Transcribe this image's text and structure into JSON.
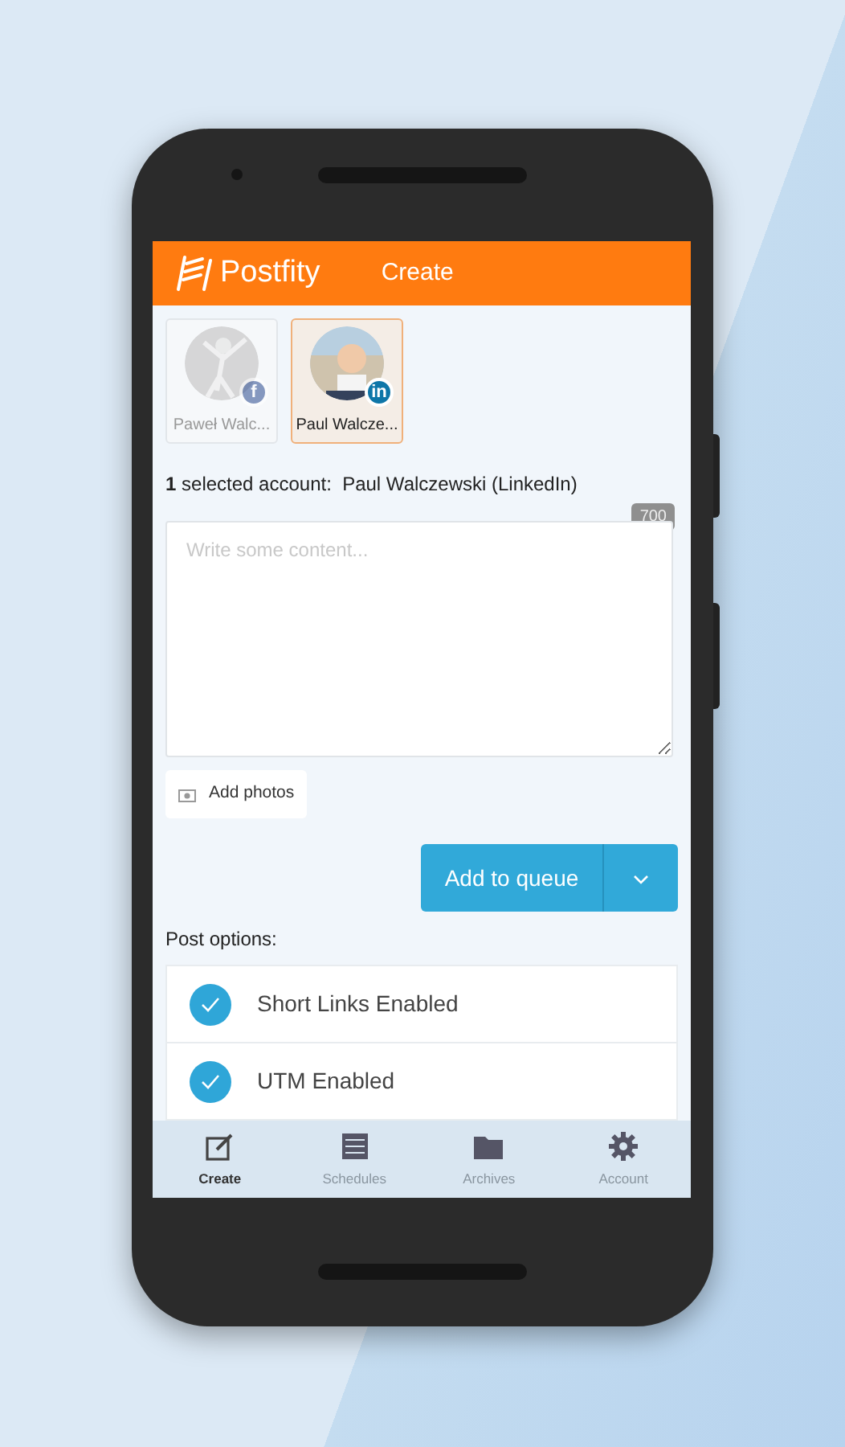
{
  "app_bar": {
    "logo": "Postfity",
    "title": "Create"
  },
  "accounts": [
    {
      "name": "Paweł Walc...",
      "kind": "facebook",
      "badge": "f",
      "selected": false
    },
    {
      "name": "Paul Walcze...",
      "kind": "linkedin",
      "badge": "in",
      "selected": true
    }
  ],
  "selection_summary": {
    "count": "1",
    "label": "selected account:",
    "accounts": "Paul Walczewski (LinkedIn)"
  },
  "composer": {
    "char_counter": "700",
    "placeholder": "Write some content..."
  },
  "add_photos": "Add photos",
  "add_to_queue": "Add to queue",
  "post_options": {
    "heading": "Post options:",
    "items": [
      {
        "label": "Short Links Enabled",
        "checked": true
      },
      {
        "label": "UTM Enabled",
        "checked": true
      }
    ]
  },
  "bottom_nav": [
    {
      "label": "Create",
      "kind": "create",
      "selected": true
    },
    {
      "label": "Schedules",
      "kind": "schedules",
      "selected": false
    },
    {
      "label": "Archives",
      "kind": "archives",
      "selected": false
    },
    {
      "label": "Account",
      "kind": "account",
      "selected": false
    }
  ]
}
